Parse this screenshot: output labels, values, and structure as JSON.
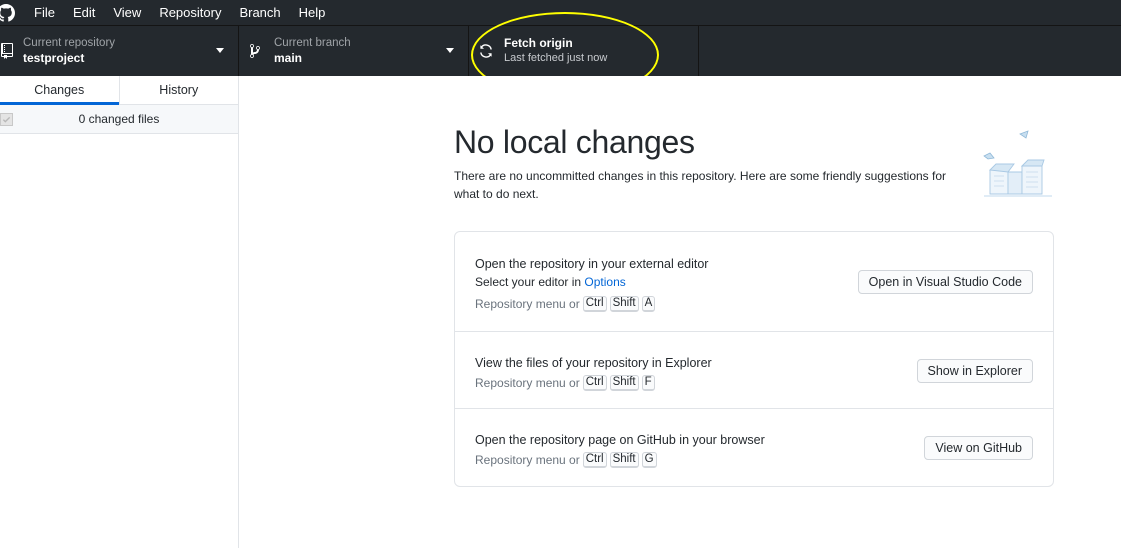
{
  "menubar": {
    "items": [
      "File",
      "Edit",
      "View",
      "Repository",
      "Branch",
      "Help"
    ]
  },
  "toolbar": {
    "repository": {
      "title": "Current repository",
      "value": "testproject"
    },
    "branch": {
      "title": "Current branch",
      "value": "main"
    },
    "fetch": {
      "title": "Fetch origin",
      "value": "Last fetched just now"
    }
  },
  "sidebar": {
    "tabs": [
      "Changes",
      "History"
    ],
    "active_tab": "Changes",
    "changed_files": "0 changed files"
  },
  "main": {
    "heading": "No local changes",
    "description": "There are no uncommitted changes in this repository. Here are some friendly suggestions for what to do next.",
    "suggestions": [
      {
        "title": "Open the repository in your external editor",
        "subtitle_prefix": "Select your editor in ",
        "subtitle_link": "Options",
        "shortcut_prefix": "Repository menu or",
        "keys": [
          "Ctrl",
          "Shift",
          "A"
        ],
        "button": "Open in Visual Studio Code"
      },
      {
        "title": "View the files of your repository in Explorer",
        "shortcut_prefix": "Repository menu or",
        "keys": [
          "Ctrl",
          "Shift",
          "F"
        ],
        "button": "Show in Explorer"
      },
      {
        "title": "Open the repository page on GitHub in your browser",
        "shortcut_prefix": "Repository menu or",
        "keys": [
          "Ctrl",
          "Shift",
          "G"
        ],
        "button": "View on GitHub"
      }
    ]
  },
  "colors": {
    "toolbar_bg": "#24292e",
    "accent": "#0366d6",
    "highlight": "#ffff00"
  }
}
